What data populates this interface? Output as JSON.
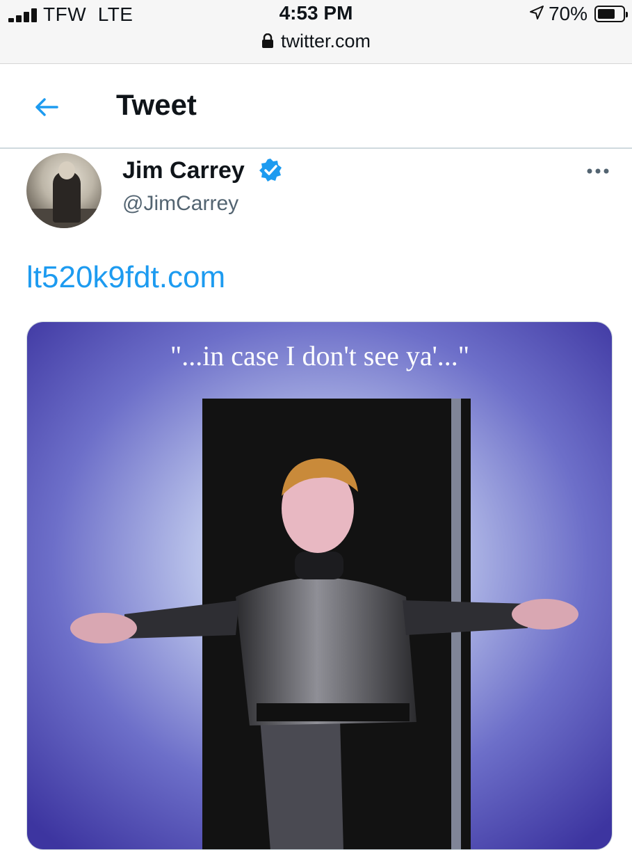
{
  "status_bar": {
    "carrier": "TFW",
    "network": "LTE",
    "time": "4:53 PM",
    "url": "twitter.com",
    "battery_percent_label": "70%",
    "battery_level": 0.7,
    "icons": [
      "signal-icon",
      "lock-icon",
      "location-icon",
      "battery-icon"
    ]
  },
  "header": {
    "title": "Tweet",
    "back_icon": "arrow-left-icon"
  },
  "tweet": {
    "author_name": "Jim Carrey",
    "author_handle": "@JimCarrey",
    "verified": true,
    "text_link": "lt520k9fdt.com",
    "more_icon": "more-horizontal-icon",
    "media": {
      "caption_text": "\"...in case I don't see ya'...\"",
      "description_icon": "illustration-image"
    }
  },
  "colors": {
    "accent": "#1d9bf0",
    "secondary_text": "#536471",
    "background": "#ffffff",
    "status_bar_bg": "#f6f6f6"
  }
}
